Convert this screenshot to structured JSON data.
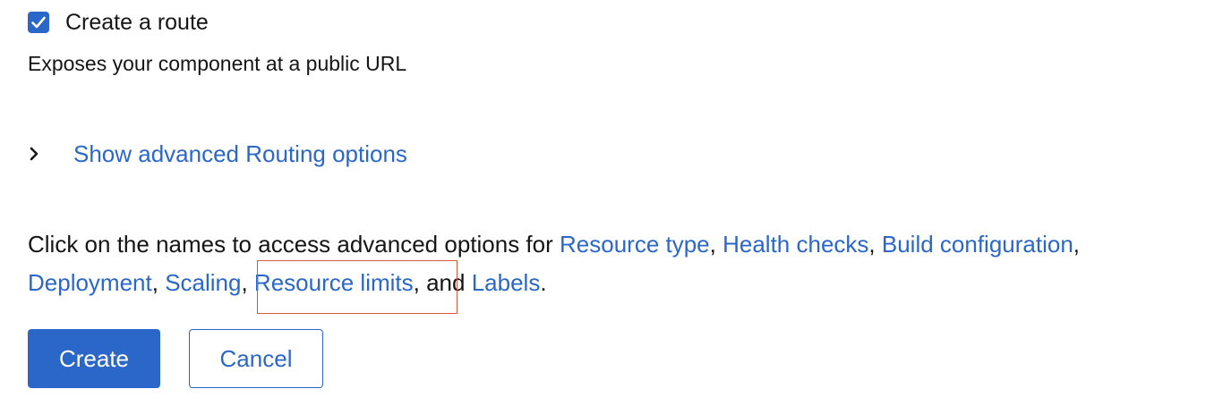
{
  "route": {
    "checkbox_checked": true,
    "label": "Create a route",
    "helper": "Exposes your component at a public URL"
  },
  "advanced_routing": {
    "label": "Show advanced Routing options",
    "icon": "chevron-right-icon"
  },
  "advanced_info": {
    "intro": "Click on the names to access advanced options for ",
    "links": {
      "resource_type": "Resource type",
      "health_checks": "Health checks",
      "build_configuration": "Build configuration",
      "deployment": "Deployment",
      "scaling": "Scaling",
      "resource_limits": "Resource limits",
      "labels": "Labels"
    },
    "sep_comma": ", ",
    "sep_and": ", and ",
    "end": "."
  },
  "actions": {
    "create": "Create",
    "cancel": "Cancel"
  },
  "colors": {
    "link": "#2b67c9",
    "primary": "#2b67c9",
    "text": "#151515",
    "highlight": "#e0563a"
  }
}
